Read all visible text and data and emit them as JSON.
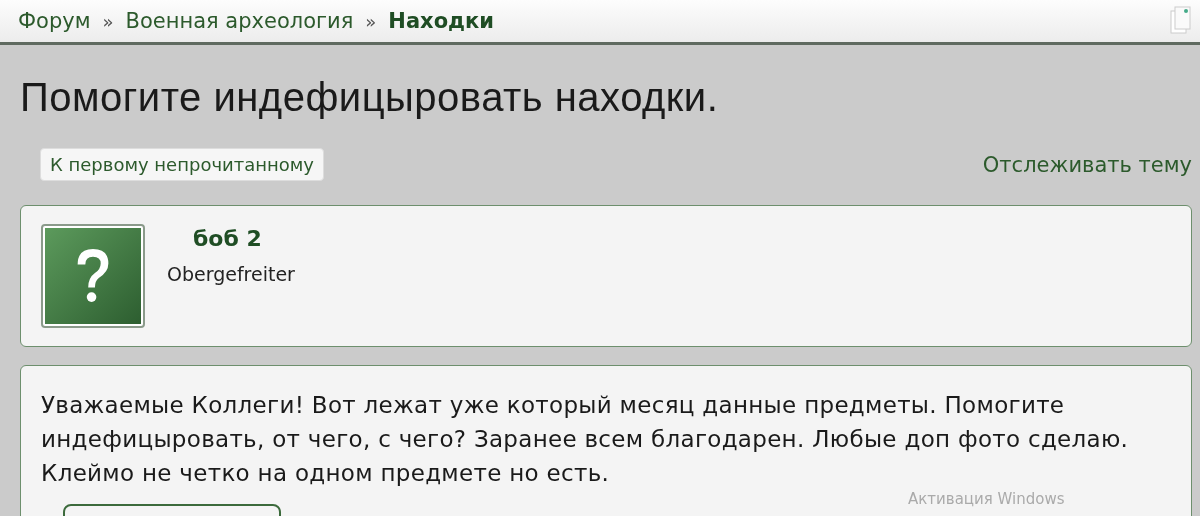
{
  "breadcrumbs": [
    {
      "label": "Форум",
      "selected": false
    },
    {
      "label": "Военная археология",
      "selected": false
    },
    {
      "label": "Находки",
      "selected": true
    }
  ],
  "breadcrumb_separator": "»",
  "title": "Помогите индефицыровать находки.",
  "first_unread_button": "К первому непрочитанному",
  "watch_link": "Отслеживать тему",
  "author": {
    "name": "боб 2",
    "rank": "Obergefreiter"
  },
  "post": {
    "text": "Уважаемые Коллеги! Вот лежат уже который месяц данные предметы. Помогите индефицыровать, от чего, с чего? Заранее всем благодарен. Любые доп фото сделаю. Клеймо не четко на одном предмете но есть."
  },
  "activation_notice": "Активация Windows"
}
